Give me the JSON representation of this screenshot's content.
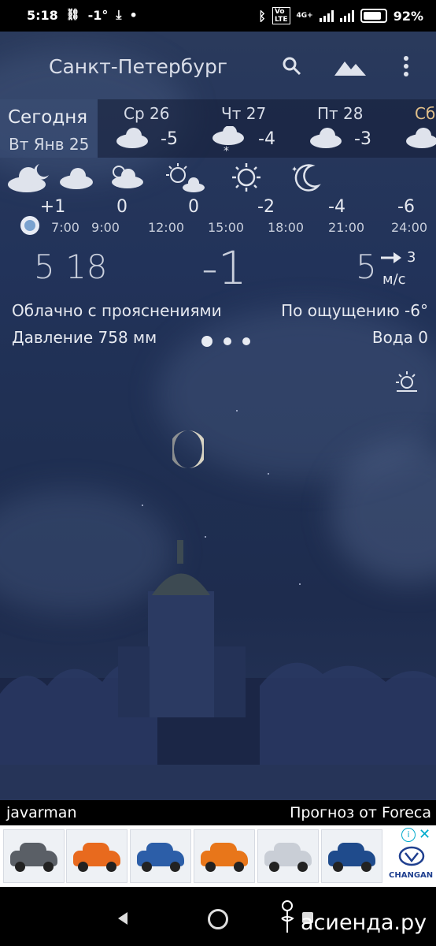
{
  "status_bar": {
    "time": "5:18",
    "temp": "-1°",
    "dot": "•",
    "network": "4G+",
    "battery": "92%"
  },
  "header": {
    "city": "Санкт-Петербург",
    "icons": [
      "search-icon",
      "landscape-icon",
      "more-vertical-icon"
    ]
  },
  "days": [
    {
      "name": "Сегодня",
      "date": "Вт Янв 25",
      "selected": true
    },
    {
      "name": "Ср 26",
      "temp": "-5",
      "icon": "cloud-icon"
    },
    {
      "name": "Чт 27",
      "temp": "-4",
      "icon": "snow-cloud-icon"
    },
    {
      "name": "Пт 28",
      "temp": "-3",
      "icon": "cloud-icon"
    },
    {
      "name": "Сб",
      "icon": "cloud-icon"
    }
  ],
  "hourly": [
    {
      "temp": "+1",
      "time": "7:00",
      "icon": "night-cloud-icon"
    },
    {
      "temp": "0",
      "time": "9:00",
      "icon": "cloud-icon"
    },
    {
      "temp": "0",
      "time": "12:00",
      "icon": "partly-sunny-icon"
    },
    {
      "temp": "",
      "time": "15:00",
      "icon": "sun-cloud-icon"
    },
    {
      "temp": "-2",
      "time": "18:00",
      "icon": "sun-icon"
    },
    {
      "temp": "-4",
      "time": "21:00",
      "icon": "moon-icon"
    },
    {
      "temp": "-6",
      "time": "24:00",
      "icon": ""
    }
  ],
  "current": {
    "time": "5 18",
    "temp": "-1",
    "wind_speed": "5",
    "wind_dir": "3",
    "wind_unit": "м/с",
    "condition": "Облачно с прояснениями",
    "feels_like": "По ощущению -6°",
    "pressure": "Давление 758 мм",
    "water": "Вода 0"
  },
  "footer": {
    "left": "javarman",
    "right": "Прогноз от Foreca"
  },
  "ad": {
    "brand": "CHANGAN",
    "car_colors": [
      "#5a5f66",
      "#e86a1e",
      "#2c5ea8",
      "#e8761a",
      "#c9ced6",
      "#1f4b8c"
    ]
  },
  "watermark": "асиенда.ру"
}
